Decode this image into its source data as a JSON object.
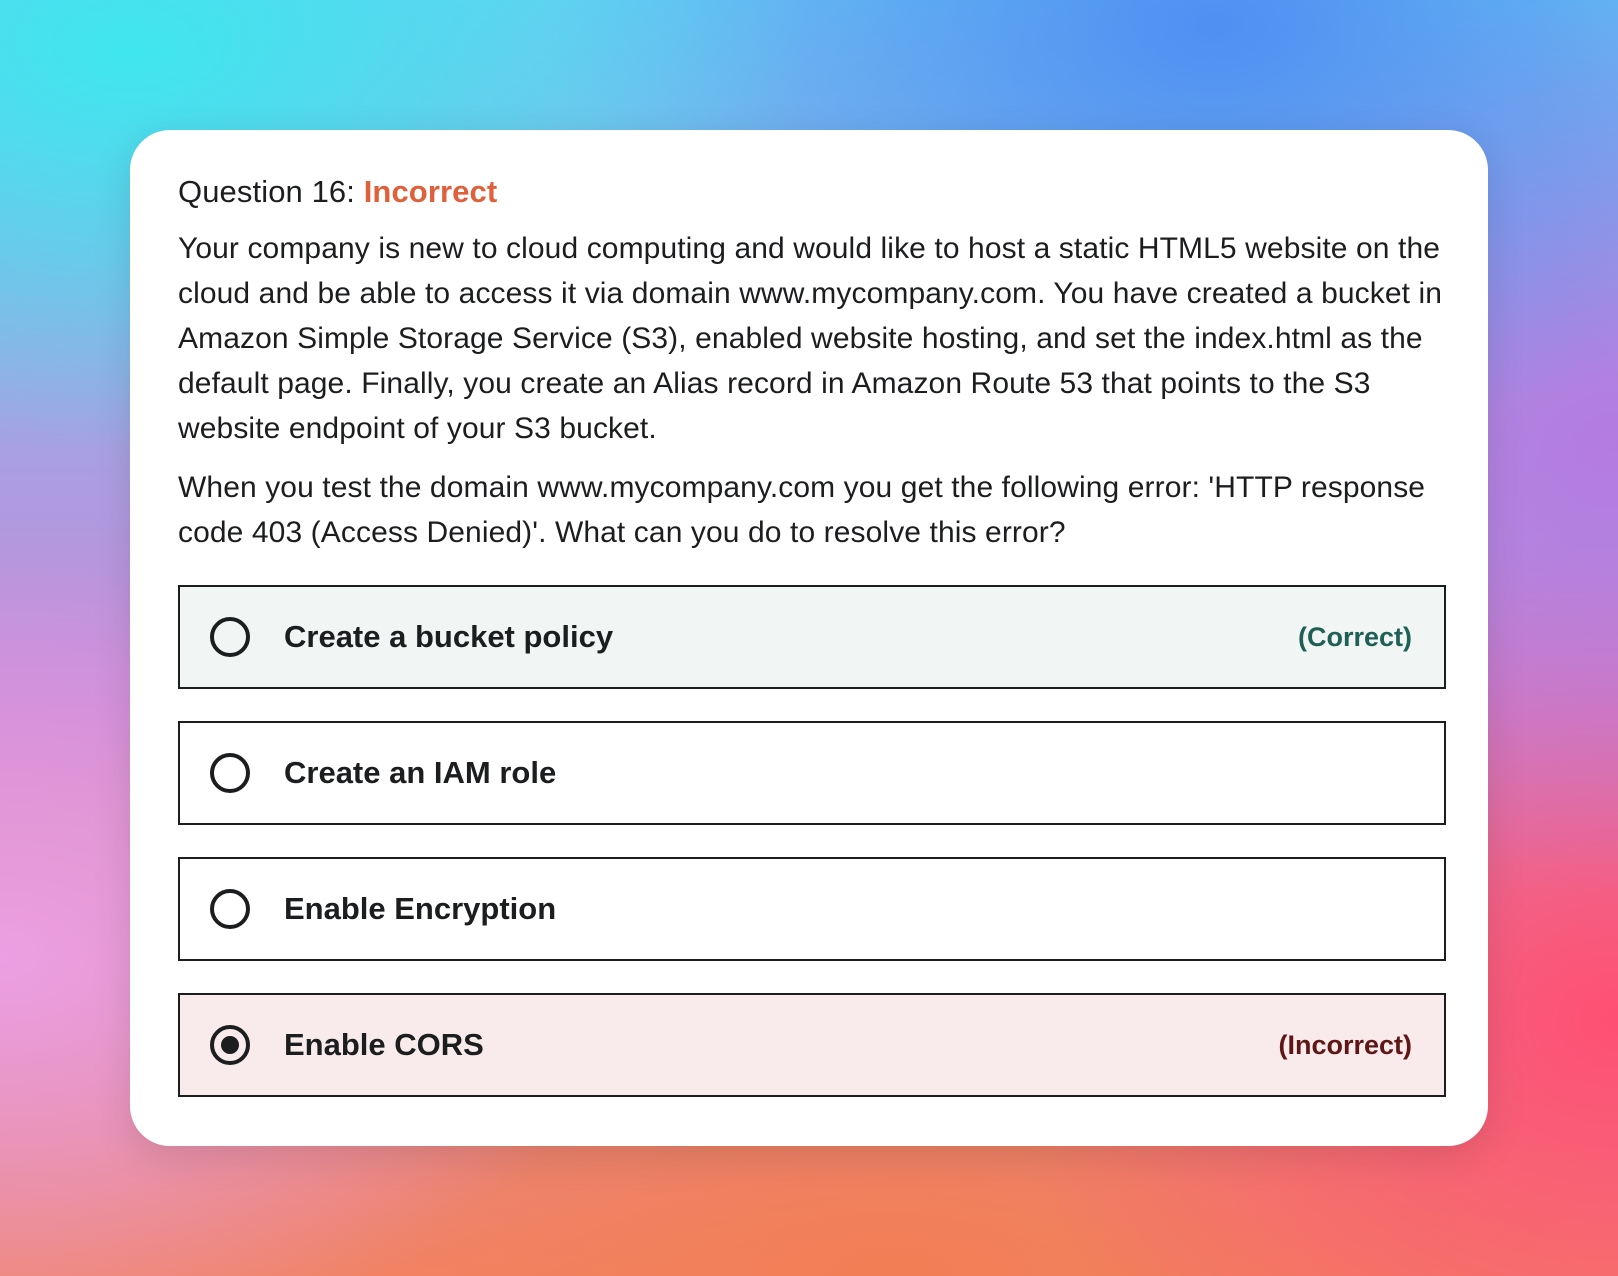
{
  "question": {
    "label": "Question 16:",
    "status": "Incorrect",
    "paragraphs": [
      "Your company is new to cloud computing and would like to host a static HTML5 website on the cloud and be able to access it via domain www.mycompany.com. You have created a bucket in Amazon Simple Storage Service (S3), enabled website hosting, and set the index.html as the default page. Finally, you create an Alias record in Amazon Route 53 that points to the S3 website endpoint of your S3 bucket.",
      "When you test the domain www.mycompany.com you get the following error: 'HTTP response code 403 (Access Denied)'. What can you do to resolve this error?"
    ]
  },
  "options": [
    {
      "label": "Create a bucket policy",
      "result": "(Correct)",
      "selected": false
    },
    {
      "label": "Create an IAM role",
      "result": "",
      "selected": false
    },
    {
      "label": "Enable Encryption",
      "result": "",
      "selected": false
    },
    {
      "label": "Enable CORS",
      "result": "(Incorrect)",
      "selected": true
    }
  ],
  "colors": {
    "status_incorrect": "#e0603b",
    "correct_text": "#1e6055",
    "incorrect_text": "#5e1616",
    "correct_bg": "#f1f5f4",
    "incorrect_bg": "#f9ebeb"
  }
}
